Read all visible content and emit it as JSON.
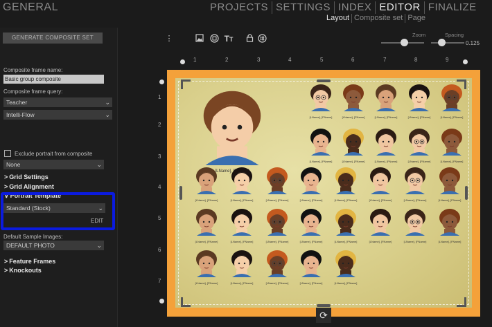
{
  "app": {
    "title": "GENERAL"
  },
  "nav": {
    "tabs": [
      {
        "label": "PROJECTS"
      },
      {
        "label": "SETTINGS"
      },
      {
        "label": "INDEX"
      },
      {
        "label": "EDITOR"
      },
      {
        "label": "FINALIZE"
      }
    ],
    "active_tab": "EDITOR",
    "subtabs": [
      {
        "label": "Layout"
      },
      {
        "label": "Composite set"
      },
      {
        "label": "Page"
      }
    ],
    "active_subtab": "Layout"
  },
  "left_panel": {
    "generate_button": "GENERATE COMPOSITE SET",
    "frame_name_label": "Composite frame name:",
    "frame_name_value": "Basic group composite",
    "frame_query_label": "Composite frame query:",
    "query_select_1": "Teacher",
    "query_select_2": "Intelli-Flow",
    "exclude_label": "Exclude portrait from composite",
    "exclude_checked": false,
    "exclude_select": "None",
    "sections": {
      "grid_settings": "Grid Settings",
      "grid_alignment": "Grid Alignment",
      "portrait_template": "Portrait Template",
      "feature_frames": "Feature Frames",
      "knockouts": "Knockouts"
    },
    "portrait_template_select": "Standard (Stock)",
    "edit_label": "EDIT",
    "sample_images_label": "Default Sample Images:",
    "sample_images_select": "DEFAULT PHOTO",
    "highlight_color": "#0b1bdf"
  },
  "toolbar": {
    "zoom_label": "Zoom",
    "spacing_label": "Spacing",
    "spacing_value": "0.125"
  },
  "rulers": {
    "horizontal": [
      "1",
      "2",
      "3",
      "4",
      "5",
      "6",
      "7",
      "8",
      "9"
    ],
    "vertical": [
      "1",
      "2",
      "3",
      "4",
      "5",
      "6",
      "7"
    ]
  },
  "page": {
    "border_color": "#f4a13a",
    "teacher_name": "[LName], [FName]",
    "student_name": "[LName], [FName]"
  }
}
